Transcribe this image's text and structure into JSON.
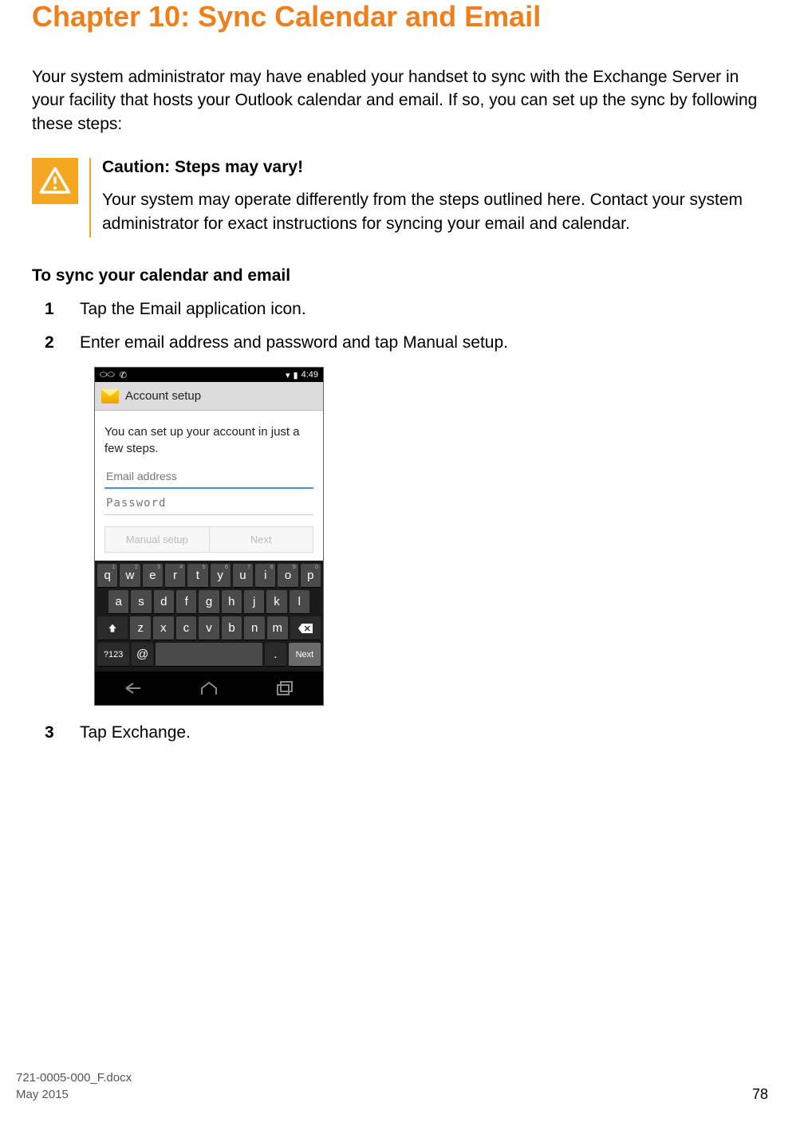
{
  "chapter": {
    "title": "Chapter 10: Sync Calendar and Email"
  },
  "intro": "Your system administrator may have enabled your handset to sync with the Exchange Server in your facility that hosts your Outlook calendar and email. If so, you can set up the sync by following these steps:",
  "caution": {
    "title": "Caution: Steps may vary!",
    "body": "Your system may operate differently from the steps outlined here. Contact your system administrator for exact instructions for syncing your email and calendar."
  },
  "section_title": "To sync your calendar and email",
  "steps": [
    {
      "num": "1",
      "text": "Tap the Email application icon."
    },
    {
      "num": "2",
      "text": "Enter email address and password and tap Manual setup."
    },
    {
      "num": "3",
      "text": "Tap Exchange."
    }
  ],
  "screenshot": {
    "status_time": "4:49",
    "header": "Account setup",
    "body_text": "You can set up your account in just a few steps.",
    "email_placeholder": "Email address",
    "password_placeholder": "Password",
    "btn_manual": "Manual setup",
    "btn_next": "Next",
    "keyboard": {
      "row1": [
        "q",
        "w",
        "e",
        "r",
        "t",
        "y",
        "u",
        "i",
        "o",
        "p"
      ],
      "row1_hints": [
        "1",
        "2",
        "3",
        "4",
        "5",
        "6",
        "7",
        "8",
        "9",
        "0"
      ],
      "row2": [
        "a",
        "s",
        "d",
        "f",
        "g",
        "h",
        "j",
        "k",
        "l"
      ],
      "row3": [
        "z",
        "x",
        "c",
        "v",
        "b",
        "n",
        "m"
      ],
      "sym_key": "?123",
      "at_key": "@",
      "period_key": ".",
      "next_key": "Next"
    }
  },
  "footer": {
    "filename": "721-0005-000_F.docx",
    "date": "May 2015",
    "page_number": "78"
  }
}
